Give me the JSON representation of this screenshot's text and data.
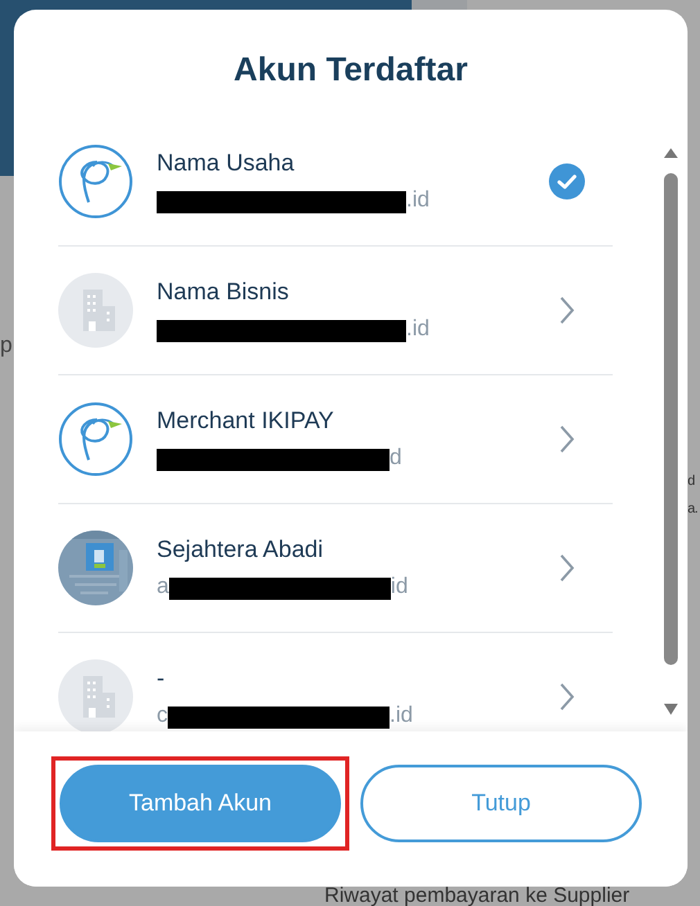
{
  "background": {
    "fragments_left": [
      "p"
    ],
    "fragments_right": [
      "d",
      "a."
    ],
    "footer_text": "Riwayat pembayaran ke Supplier"
  },
  "dialog": {
    "title": "Akun Terdaftar",
    "accounts": [
      {
        "name": "Nama Usaha",
        "email_suffix": ".id",
        "kind": "logo",
        "selected": true
      },
      {
        "name": "Nama Bisnis",
        "email_suffix": ".id",
        "kind": "building",
        "selected": false
      },
      {
        "name": "Merchant IKIPAY",
        "email_suffix": "d",
        "kind": "logo",
        "selected": false
      },
      {
        "name": "Sejahtera Abadi",
        "email_prefix": "a",
        "email_suffix": "id",
        "kind": "picture",
        "selected": false
      },
      {
        "name": "-",
        "email_prefix": "c",
        "email_suffix": ".id",
        "kind": "building",
        "selected": false
      }
    ],
    "buttons": [
      {
        "label": "Tambah Akun",
        "kind": "primary",
        "highlighted": true
      },
      {
        "label": "Tutup",
        "kind": "outline",
        "highlighted": false
      }
    ]
  }
}
